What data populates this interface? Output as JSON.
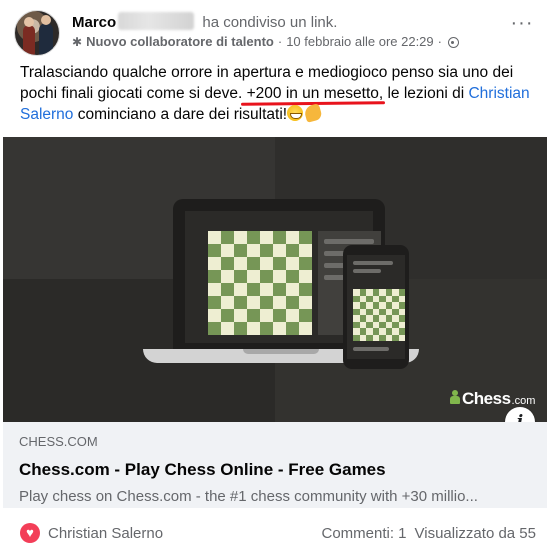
{
  "post": {
    "author": "Marco",
    "action": "ha condiviso un link.",
    "badge": "Nuovo collaboratore di talento",
    "separator": "·",
    "timestamp": "10 febbraio alle ore 22:29",
    "timestamp_separator": "·",
    "privacy_icon": "globe-icon",
    "text_before": "Tralasciando qualche orrore in apertura e mediogioco penso sia uno dei pochi finali giocati come si deve. ",
    "text_highlight": "+200 in un mesetto",
    "text_middle": ", le lezioni di ",
    "mention": "Christian Salerno",
    "text_after": " cominciano a dare dei risultati!"
  },
  "link": {
    "domain": "CHESS.COM",
    "title": "Chess.com - Play Chess Online - Free Games",
    "description": "Play chess on Chess.com - the #1 chess community with +30 millio...",
    "logo_main": "Chess",
    "logo_tld": ".com",
    "info_label": "i"
  },
  "footer": {
    "reaction_icon": "love-icon",
    "reactor": "Christian Salerno",
    "comments": "Commenti: 1",
    "views": "Visualizzato da 55"
  },
  "colors": {
    "accent": "#216fdb",
    "underline": "#e8131c",
    "board_light": "#eeeed2",
    "board_dark": "#769656",
    "love": "#f33e58"
  }
}
